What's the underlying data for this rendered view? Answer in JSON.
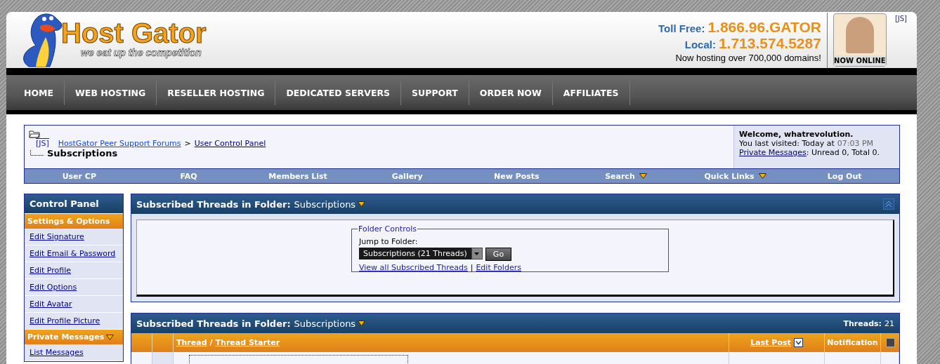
{
  "header": {
    "logo": {
      "title": "Host Gator",
      "tagline": "we eat up the competition"
    },
    "contact": {
      "toll_free_label": "Toll Free:",
      "toll_free_number": "1.866.96.GATOR",
      "local_label": "Local:",
      "local_number": "1.713.574.5287",
      "note": "Now hosting over 700,000 domains!"
    },
    "support_badge": "NOW ONLINE",
    "js_link": "[JS]"
  },
  "main_nav": [
    {
      "label": "HOME"
    },
    {
      "label": "WEB HOSTING"
    },
    {
      "label": "RESELLER HOSTING"
    },
    {
      "label": "DEDICATED SERVERS"
    },
    {
      "label": "SUPPORT"
    },
    {
      "label": "ORDER NOW"
    },
    {
      "label": "AFFILIATES"
    }
  ],
  "breadcrumb": {
    "js_link": "[JS]",
    "links": [
      "HostGator Peer Support Forums",
      "User Control Panel"
    ],
    "separator": ">",
    "current": "Subscriptions"
  },
  "welcome": {
    "title": "Welcome, whatrevolution.",
    "visited_label": "You last visited: Today at",
    "visited_time": "07:03 PM",
    "pm_link": "Private Messages",
    "pm_text": ": Unread 0, Total 0."
  },
  "forum_nav": [
    {
      "label": "User CP",
      "has_menu": false
    },
    {
      "label": "FAQ",
      "has_menu": false
    },
    {
      "label": "Members List",
      "has_menu": false
    },
    {
      "label": "Gallery",
      "has_menu": false
    },
    {
      "label": "New Posts",
      "has_menu": false
    },
    {
      "label": "Search",
      "has_menu": true
    },
    {
      "label": "Quick Links",
      "has_menu": true
    },
    {
      "label": "Log Out",
      "has_menu": false
    }
  ],
  "sidebar": {
    "title": "Control Panel",
    "sections": [
      {
        "title": "Settings & Options",
        "has_menu": false,
        "items": [
          "Edit Signature",
          "Edit Email & Password",
          "Edit Profile",
          "Edit Options",
          "Edit Avatar",
          "Edit Profile Picture"
        ]
      },
      {
        "title": "Private Messages",
        "has_menu": true,
        "items": [
          "List Messages"
        ]
      }
    ]
  },
  "folder_panel": {
    "title": "Subscribed Threads in Folder:",
    "folder": "Subscriptions",
    "legend": "Folder Controls",
    "jump_label": "Jump to Folder:",
    "select_value": "Subscriptions (21 Threads)",
    "go_button": "Go",
    "links": [
      "View all Subscribed Threads",
      "Edit Folders"
    ],
    "link_separator": "|"
  },
  "threads_panel": {
    "title": "Subscribed Threads in Folder:",
    "folder": "Subscriptions",
    "count_label": "Threads:",
    "count": "21",
    "columns": [
      {
        "kind": "blank"
      },
      {
        "kind": "blank"
      },
      {
        "kind": "thread",
        "labels": [
          "Thread",
          "Thread Starter"
        ],
        "separator": "/"
      },
      {
        "kind": "sort",
        "label": "Last Post"
      },
      {
        "kind": "text",
        "label": "Notification"
      },
      {
        "kind": "checkbox",
        "checked": false
      }
    ]
  }
}
